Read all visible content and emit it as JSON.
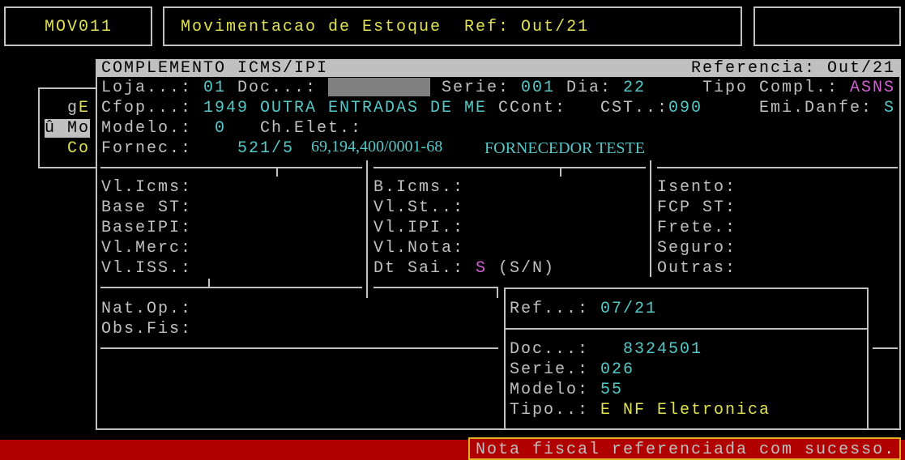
{
  "colors": {
    "background": "#000000",
    "label": "#c0c0c0",
    "value": "#55c8c8",
    "accent_yellow": "#e0e050",
    "flag_magenta": "#d060d0",
    "title_bar": "#c0c0c0",
    "title_text": "#000000",
    "focus_field": "#808080",
    "border": "#c0c0c0",
    "status_bar": "#b00000",
    "status_border": "#e0b020"
  },
  "header": {
    "program_code": "MOV011",
    "title": "Movimentacao de Estoque  Ref: Out/21"
  },
  "background_menu": {
    "items": [
      {
        "prefix": "g",
        "hotkey": "E"
      },
      {
        "label": "û Mo"
      },
      {
        "label": "Co"
      }
    ]
  },
  "window": {
    "title": "COMPLEMENTO ICMS/IPI",
    "reference": "Referencia: Out/21",
    "loja": {
      "label": "Loja...:",
      "value": "01"
    },
    "doc": {
      "label": "Doc...:"
    },
    "serie": {
      "label": "Serie:",
      "value": "001"
    },
    "dia": {
      "label": "Dia:",
      "value": "22"
    },
    "tipo_compl": {
      "label": "Tipo Compl.:",
      "value": "ASNS"
    },
    "cfop": {
      "label": "Cfop...:",
      "value": "1949 OUTRA ENTRADAS DE ME"
    },
    "ccont": {
      "label": "CCont:"
    },
    "cst": {
      "label": "CST..:",
      "value": "090"
    },
    "emi_danfe": {
      "label": "Emi.Danfe:",
      "value": "S"
    },
    "modelo": {
      "label": "Modelo.:",
      "value": "0"
    },
    "ch_elet": {
      "label": "Ch.Elet.:"
    },
    "fornec": {
      "label": "Fornec.:",
      "code": "521/5",
      "cnpj": "69,194,400/0001-68",
      "name": "FORNECEDOR TESTE"
    },
    "totals_left": [
      "Vl.Icms:",
      "Base ST:",
      "BaseIPI:",
      "Vl.Merc:",
      "Vl.ISS.:"
    ],
    "totals_middle": [
      "B.Icms.:",
      "Vl.St..:",
      "Vl.IPI.:",
      "Vl.Nota:"
    ],
    "dt_sai": {
      "label": "Dt Sai.:",
      "value": "S",
      "hint": "(S/N)"
    },
    "totals_right": [
      "Isento:",
      "FCP ST:",
      "Frete.:",
      "Seguro:",
      "Outras:"
    ],
    "nat_op": {
      "label": "Nat.Op.:"
    },
    "obs_fis": {
      "label": "Obs.Fis:"
    }
  },
  "reference_popup": {
    "ref": {
      "label": "Ref...:",
      "value": "07/21"
    },
    "doc": {
      "label": "Doc...:",
      "value": "8324501"
    },
    "serie": {
      "label": "Serie.:",
      "value": "026"
    },
    "modelo": {
      "label": "Modelo:",
      "value": "55"
    },
    "tipo": {
      "label": "Tipo..:",
      "value": "E NF Eletronica"
    }
  },
  "status": {
    "message": "Nota fiscal referenciada com sucesso."
  }
}
